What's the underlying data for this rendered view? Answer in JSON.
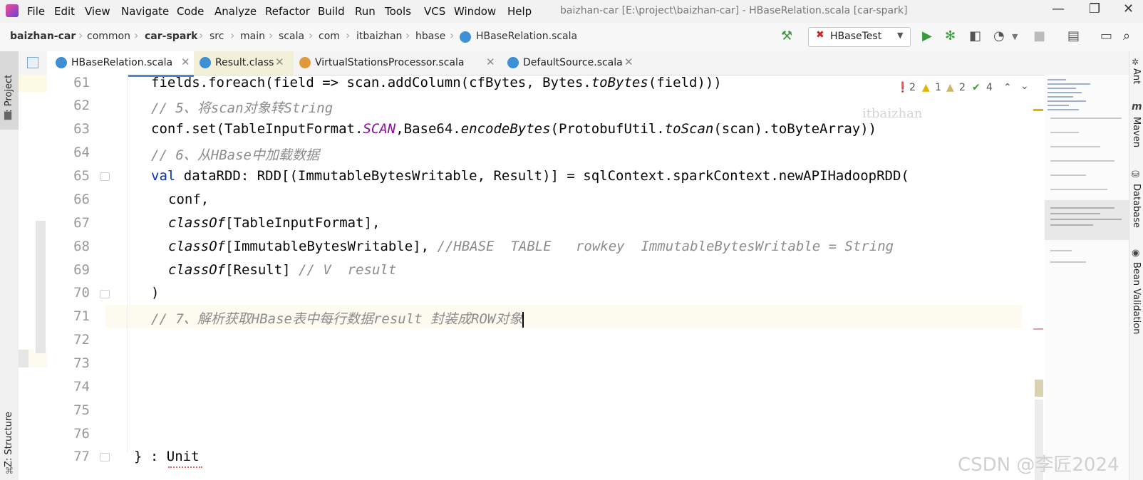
{
  "menubar": {
    "items": [
      "File",
      "Edit",
      "View",
      "Navigate",
      "Code",
      "Analyze",
      "Refactor",
      "Build",
      "Run",
      "Tools",
      "VCS",
      "Window",
      "Help"
    ],
    "title": "baizhan-car [E:\\project\\baizhan-car] - HBaseRelation.scala [car-spark]"
  },
  "breadcrumb": [
    "baizhan-car",
    "common",
    "car-spark",
    "src",
    "main",
    "scala",
    "com",
    "itbaizhan",
    "hbase",
    "HBaseRelation.scala"
  ],
  "run_config": "HBaseTest",
  "left_tools": {
    "project": "1: Project",
    "structure": "Z: Structure"
  },
  "right_tools": [
    "Ant",
    "Maven",
    "Database",
    "Bean Validation"
  ],
  "tabs": [
    {
      "label": "HBaseRelation.scala",
      "color": "#3d8fd6"
    },
    {
      "label": "Result.class",
      "color": "#3d8fd6"
    },
    {
      "label": "VirtualStationsProcessor.scala",
      "color": "#e09a3b"
    },
    {
      "label": "DefaultSource.scala",
      "color": "#3d8fd6"
    }
  ],
  "inspections": {
    "errors": "2",
    "warnings": "1",
    "weak": "2",
    "typos": "4"
  },
  "watermark": "itbaizhan",
  "corner_watermark": "CSDN @李匠2024",
  "line_numbers": [
    "61",
    "62",
    "63",
    "64",
    "65",
    "66",
    "67",
    "68",
    "69",
    "70",
    "71",
    "72",
    "73",
    "74",
    "75",
    "76",
    "77"
  ],
  "code": {
    "l61a": "fields.foreach(field => scan.addColumn(cfBytes, Bytes.",
    "l61b": "toBytes",
    "l61c": "(field)))",
    "l62": "// 5、将scan对象转String",
    "l63a": "conf.set(TableInputFormat.",
    "l63b": "SCAN",
    "l63c": ",Base64.",
    "l63d": "encodeBytes",
    "l63e": "(ProtobufUtil.",
    "l63f": "toScan",
    "l63g": "(scan).toByteArray))",
    "l64": "// 6、从HBase中加载数据",
    "l65a": "val",
    "l65b": " dataRDD: RDD[(ImmutableBytesWritable, Result)] = sqlContext.sparkContext.newAPIHadoopRDD(",
    "l66": "conf,",
    "l67a": "classOf",
    "l67b": "[TableInputFormat],",
    "l68a": "classOf",
    "l68b": "[ImmutableBytesWritable], ",
    "l68c": "//HBASE  TABLE   rowkey  ImmutableBytesWritable = String",
    "l69a": "classOf",
    "l69b": "[Result] ",
    "l69c": "// V  result",
    "l70": ")",
    "l71": "// 7、解析获取HBase表中每行数据result 封装成ROW对象",
    "l77": "} : Unit"
  }
}
